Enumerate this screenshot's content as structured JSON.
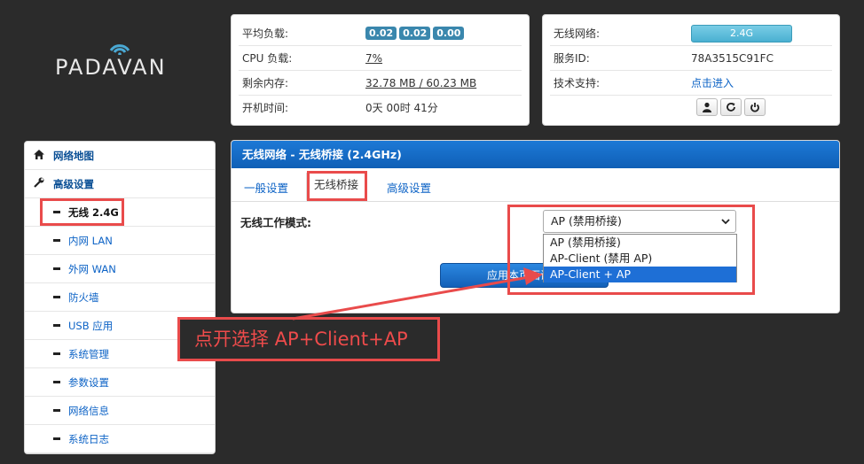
{
  "logo": {
    "text": "PADAVAN"
  },
  "status": {
    "load_label": "平均负载:",
    "load_values": [
      "0.02",
      "0.02",
      "0.00"
    ],
    "cpu_label": "CPU 负载:",
    "cpu_value": "7%",
    "mem_label": "剩余内存:",
    "mem_value": "32.78 MB / 60.23 MB",
    "uptime_label": "开机时间:",
    "uptime_value": "0天 00时 41分"
  },
  "network": {
    "wireless_label": "无线网络:",
    "wireless_band": "2.4G",
    "service_id_label": "服务ID:",
    "service_id_value": "78A3515C91FC",
    "support_label": "技术支持:",
    "support_link": "点击进入"
  },
  "sidebar": {
    "items": [
      {
        "label": "网络地图",
        "icon": "home-icon"
      },
      {
        "label": "高级设置",
        "icon": "wrench-icon"
      },
      {
        "label": "无线 2.4G"
      },
      {
        "label": "内网 LAN"
      },
      {
        "label": "外网 WAN"
      },
      {
        "label": "防火墙"
      },
      {
        "label": "USB 应用"
      },
      {
        "label": "系统管理"
      },
      {
        "label": "参数设置"
      },
      {
        "label": "网络信息"
      },
      {
        "label": "系统日志"
      }
    ]
  },
  "panel": {
    "title": "无线网络 - 无线桥接 (2.4GHz)",
    "tabs": [
      "一般设置",
      "无线桥接",
      "高级设置"
    ],
    "mode_label": "无线工作模式:",
    "selected_mode": "AP (禁用桥接)",
    "options": [
      "AP (禁用桥接)",
      "AP-Client (禁用 AP)",
      "AP-Client + AP"
    ],
    "apply_label": "应用本页面设置"
  },
  "annotation": {
    "text": "点开选择 AP+Client+AP",
    "color": "#e94b4b"
  }
}
